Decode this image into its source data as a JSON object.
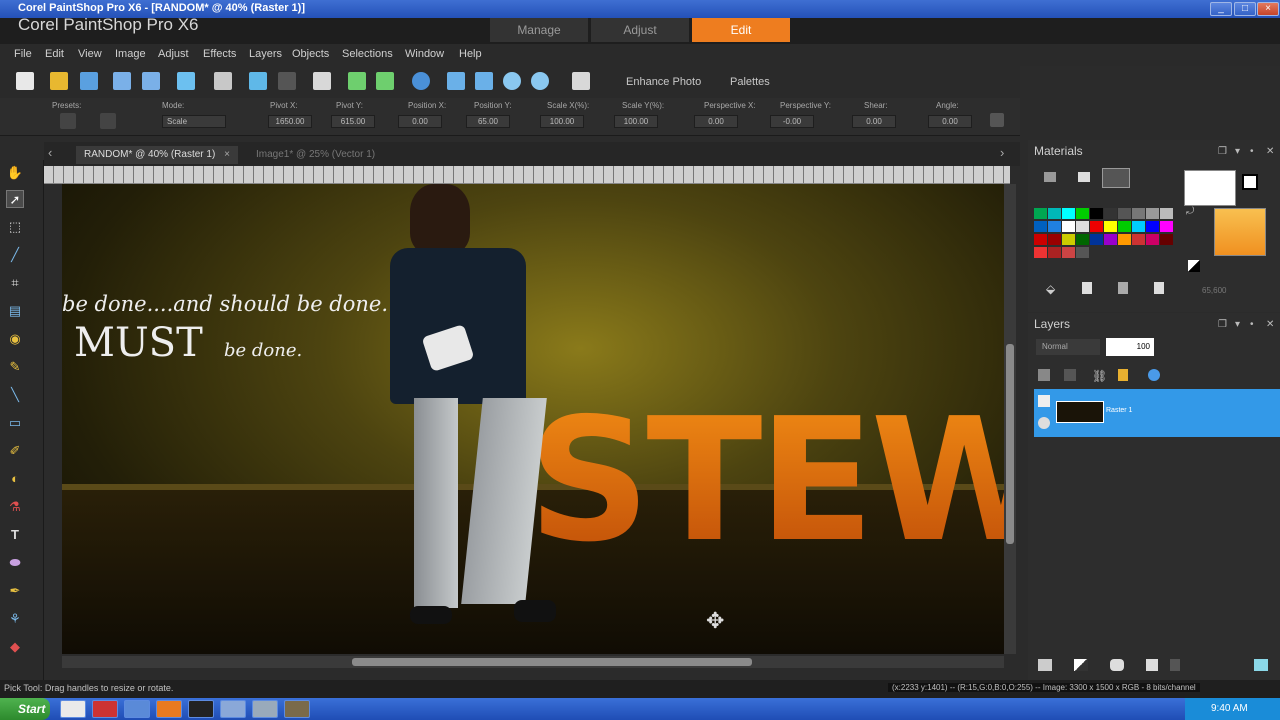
{
  "window": {
    "title": "Corel PaintShop Pro X6 - [RANDOM* @  40% (Raster 1)]",
    "app_name": "Corel PaintShop Pro X6",
    "buttons": [
      "_",
      "□",
      "×"
    ]
  },
  "workspace_tabs": [
    {
      "label": "Manage",
      "active": false
    },
    {
      "label": "Adjust",
      "active": false
    },
    {
      "label": "Edit",
      "active": true
    }
  ],
  "menu": [
    "File",
    "Edit",
    "View",
    "Image",
    "Adjust",
    "Effects",
    "Layers",
    "Objects",
    "Selections",
    "Window",
    "Help"
  ],
  "toolbar": {
    "enhance_photo": "Enhance Photo",
    "palettes": "Palettes"
  },
  "tool_options": {
    "presets_label": "Presets:",
    "mode_label": "Mode:",
    "mode_value": "Scale",
    "fields": [
      {
        "label": "Pivot X:",
        "value": "1650.00"
      },
      {
        "label": "Pivot Y:",
        "value": "615.00"
      },
      {
        "label": "Position X:",
        "value": "0.00"
      },
      {
        "label": "Position Y:",
        "value": "65.00"
      },
      {
        "label": "Scale X(%):",
        "value": "100.00"
      },
      {
        "label": "Scale Y(%):",
        "value": "100.00"
      },
      {
        "label": "Perspective X:",
        "value": "0.00"
      },
      {
        "label": "Perspective Y:",
        "value": "-0.00"
      },
      {
        "label": "Shear:",
        "value": "0.00"
      },
      {
        "label": "Angle:",
        "value": "0.00"
      }
    ]
  },
  "document_tabs": [
    {
      "label": "RANDOM* @  40% (Raster 1)",
      "active": true
    },
    {
      "label": "Image1* @  25% (Vector 1)",
      "active": false
    }
  ],
  "canvas": {
    "line1": "be done....and should be done..",
    "line2_big": "MUST",
    "line2_small": "be done.",
    "big_text": "STEWY"
  },
  "materials": {
    "title": "Materials",
    "opacity_readout": "65,600"
  },
  "layers": {
    "title": "Layers",
    "blend_mode": "Normal",
    "opacity": "100",
    "layer_name": "Raster 1"
  },
  "status": {
    "left": "Pick Tool: Drag handles to resize or rotate.",
    "right": "(x:2233 y:1401) -- (R:15,G:0,B:0,O:255) -- Image:  3300 x 1500 x RGB - 8 bits/channel"
  },
  "taskbar": {
    "start": "Start",
    "clock": "9:40 AM"
  },
  "colors": {
    "edit_tab": "#ee7d1f",
    "layer_selected": "#3399e8",
    "foreground": "#ffffff",
    "background": "#f5a623"
  }
}
